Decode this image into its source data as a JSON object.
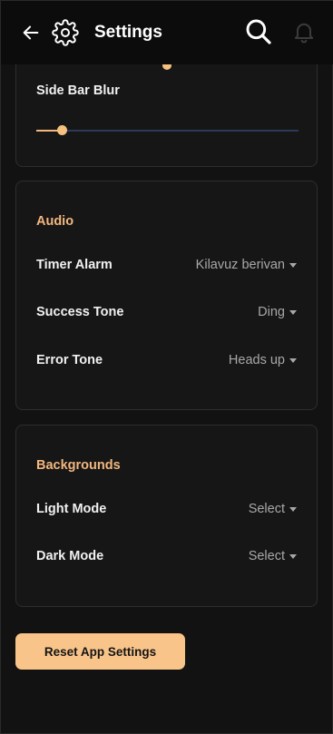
{
  "header": {
    "title": "Settings",
    "back_icon": "arrow-left-icon",
    "settings_icon": "gear-icon",
    "search_icon": "search-icon",
    "notifications_icon": "bell-icon"
  },
  "display": {
    "side_bar_blur_label": "Side Bar Blur",
    "side_bar_blur_value": 0.1
  },
  "audio": {
    "section_title": "Audio",
    "rows": [
      {
        "label": "Timer Alarm",
        "value": "Kilavuz berivan"
      },
      {
        "label": "Success Tone",
        "value": "Ding"
      },
      {
        "label": "Error Tone",
        "value": "Heads up"
      }
    ]
  },
  "backgrounds": {
    "section_title": "Backgrounds",
    "rows": [
      {
        "label": "Light Mode",
        "value": "Select"
      },
      {
        "label": "Dark Mode",
        "value": "Select"
      }
    ]
  },
  "actions": {
    "reset_label": "Reset App Settings"
  },
  "colors": {
    "accent": "#f3b77f",
    "button_bg": "#f8c489",
    "background": "#121212",
    "card_border": "#2e2e2e"
  }
}
